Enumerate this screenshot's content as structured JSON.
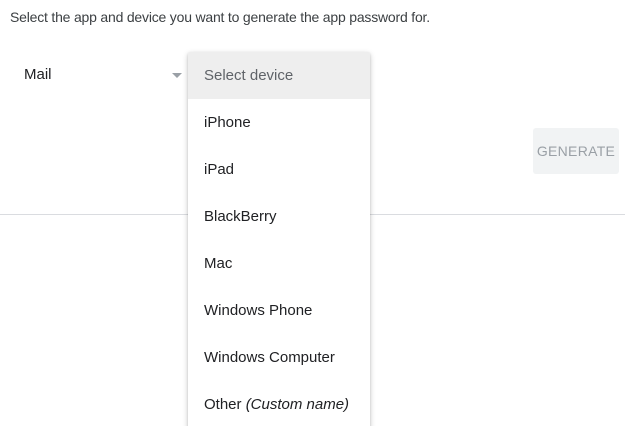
{
  "instruction": "Select the app and device you want to generate the app password for.",
  "app_select": {
    "value": "Mail",
    "icon": "caret-down-icon"
  },
  "device_menu": {
    "placeholder": "Select device",
    "items": [
      {
        "label": "iPhone"
      },
      {
        "label": "iPad"
      },
      {
        "label": "BlackBerry"
      },
      {
        "label": "Mac"
      },
      {
        "label": "Windows Phone"
      },
      {
        "label": "Windows Computer"
      },
      {
        "label": "Other",
        "hint": "(Custom name)"
      }
    ]
  },
  "generate_button": {
    "label": "GENERATE"
  },
  "colors": {
    "menu_header_bg": "#eeeeee",
    "button_bg": "#f1f3f4",
    "button_text": "#9aa0a6",
    "divider": "#dadce0"
  }
}
